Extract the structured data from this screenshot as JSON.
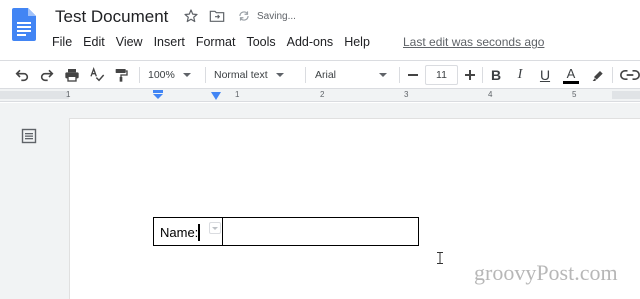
{
  "header": {
    "title": "Test Document",
    "status": "Saving...",
    "last_edit": "Last edit was seconds ago"
  },
  "menu": [
    "File",
    "Edit",
    "View",
    "Insert",
    "Format",
    "Tools",
    "Add-ons",
    "Help"
  ],
  "toolbar": {
    "zoom": "100%",
    "style": "Normal text",
    "font": "Arial",
    "font_size": "11",
    "bold": "B",
    "italic": "I",
    "underline": "U",
    "text_color": "A"
  },
  "ruler": {
    "numbers": [
      "1",
      "1",
      "2",
      "3",
      "4",
      "5"
    ]
  },
  "document": {
    "table_cell_text": "Name:"
  },
  "watermark": "groovyPost.com",
  "colors": {
    "docs_blue": "#4285f4",
    "ruler_marker": "#4285f4",
    "text_color_bar": "#000000"
  },
  "icons": [
    "docs-logo-icon",
    "star-icon",
    "move-to-folder-icon",
    "sync-icon",
    "undo-icon",
    "redo-icon",
    "print-icon",
    "spellcheck-icon",
    "paint-format-icon",
    "minus-icon",
    "plus-icon",
    "highlight-icon",
    "link-icon",
    "document-outline-icon"
  ]
}
